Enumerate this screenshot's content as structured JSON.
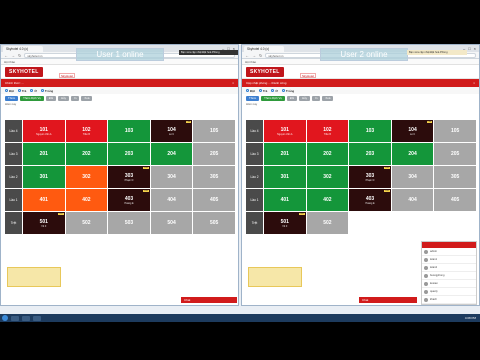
{
  "left": {
    "tab_title": "Skyhotel 4.0 (c)",
    "url": "skyhotel.vn",
    "bookmarks": "Hội thảo",
    "logo": "SKYHOTEL",
    "hotel_button": "SkyHotel",
    "banner": "User 1 online",
    "notice": "Bạn vừa cập nhật Đặt hoà Phòng",
    "alert": "Chính thức: ...",
    "toolbar": [
      "Đặt",
      "Trả",
      "Ở",
      "Trống"
    ],
    "actions": [
      {
        "label": "Thêm",
        "color": "blue"
      },
      {
        "label": "Thêm Dịch Vụ",
        "color": "green"
      },
      {
        "label": "Đổi",
        "color": "gray"
      },
      {
        "label": "Hủy",
        "color": "gray"
      },
      {
        "label": "In",
        "color": "gray"
      },
      {
        "label": "Xoá",
        "color": "gray"
      }
    ],
    "subline": "Hôm nay",
    "bottom_button": "Chat",
    "floors": [
      {
        "label": "Lầu 4",
        "rooms": [
          {
            "num": "101",
            "color": "red",
            "guest": "Nguyễn Văn A"
          },
          {
            "num": "102",
            "color": "red",
            "guest": "Trần B"
          },
          {
            "num": "103",
            "color": "green",
            "guest": ""
          },
          {
            "num": "104",
            "color": "dark",
            "guest": "Lê C",
            "tag": "Chờ"
          },
          {
            "num": "105",
            "color": "gray",
            "guest": ""
          }
        ]
      },
      {
        "label": "Lầu 3",
        "rooms": [
          {
            "num": "201",
            "color": "green",
            "guest": ""
          },
          {
            "num": "202",
            "color": "green",
            "guest": ""
          },
          {
            "num": "203",
            "color": "green",
            "guest": ""
          },
          {
            "num": "204",
            "color": "green",
            "guest": ""
          },
          {
            "num": "205",
            "color": "gray",
            "guest": ""
          }
        ]
      },
      {
        "label": "Lầu 2",
        "rooms": [
          {
            "num": "301",
            "color": "green",
            "guest": ""
          },
          {
            "num": "302",
            "color": "orange",
            "guest": ""
          },
          {
            "num": "303",
            "color": "dark",
            "guest": "Phạm D",
            "tag": "Chờ"
          },
          {
            "num": "304",
            "color": "gray",
            "guest": ""
          },
          {
            "num": "305",
            "color": "gray",
            "guest": ""
          }
        ]
      },
      {
        "label": "Lầu 1",
        "rooms": [
          {
            "num": "401",
            "color": "orange",
            "guest": ""
          },
          {
            "num": "402",
            "color": "orange",
            "guest": ""
          },
          {
            "num": "403",
            "color": "dark",
            "guest": "Hoàng E",
            "tag": "Chờ"
          },
          {
            "num": "404",
            "color": "gray",
            "guest": ""
          },
          {
            "num": "405",
            "color": "gray",
            "guest": ""
          }
        ]
      },
      {
        "label": "Trệt",
        "rooms": [
          {
            "num": "501",
            "color": "dark",
            "guest": "Vũ F",
            "tag": "Chờ"
          },
          {
            "num": "502",
            "color": "gray",
            "guest": ""
          },
          {
            "num": "503",
            "color": "gray",
            "guest": ""
          },
          {
            "num": "504",
            "color": "gray",
            "guest": ""
          },
          {
            "num": "505",
            "color": "gray",
            "guest": ""
          }
        ]
      }
    ]
  },
  "right": {
    "tab_title": "Skyhotel 4.0 (c)",
    "url": "skyhotel.vn",
    "bookmarks": "Hội thảo",
    "logo": "SKYHOTEL",
    "hotel_button": "SkyHotel",
    "banner": "User 2 online",
    "notice": "Bạn vừa cập nhật Đặt hoà Phòng",
    "alert": "Cập nhật phòng ... thành công",
    "toolbar": [
      "Đặt",
      "Trả",
      "Ở",
      "Trống"
    ],
    "actions": [
      {
        "label": "Thêm",
        "color": "blue"
      },
      {
        "label": "Thêm Dịch Vụ",
        "color": "green"
      },
      {
        "label": "Đổi",
        "color": "gray"
      },
      {
        "label": "Hủy",
        "color": "gray"
      },
      {
        "label": "In",
        "color": "gray"
      },
      {
        "label": "Xoá",
        "color": "gray"
      }
    ],
    "subline": "Hôm nay",
    "bottom_button": "Chat",
    "floors": [
      {
        "label": "Lầu 4",
        "rooms": [
          {
            "num": "101",
            "color": "red",
            "guest": "Nguyễn Văn A"
          },
          {
            "num": "102",
            "color": "red",
            "guest": "Trần B"
          },
          {
            "num": "103",
            "color": "green",
            "guest": ""
          },
          {
            "num": "104",
            "color": "dark",
            "guest": "Lê C",
            "tag": "Chờ"
          },
          {
            "num": "105",
            "color": "gray",
            "guest": ""
          }
        ]
      },
      {
        "label": "Lầu 3",
        "rooms": [
          {
            "num": "201",
            "color": "green",
            "guest": ""
          },
          {
            "num": "202",
            "color": "green",
            "guest": ""
          },
          {
            "num": "203",
            "color": "green",
            "guest": ""
          },
          {
            "num": "204",
            "color": "green",
            "guest": ""
          },
          {
            "num": "205",
            "color": "gray",
            "guest": ""
          }
        ]
      },
      {
        "label": "Lầu 2",
        "rooms": [
          {
            "num": "301",
            "color": "green",
            "guest": ""
          },
          {
            "num": "302",
            "color": "green",
            "guest": ""
          },
          {
            "num": "303",
            "color": "dark",
            "guest": "Phạm D",
            "tag": "Chờ"
          },
          {
            "num": "304",
            "color": "gray",
            "guest": ""
          },
          {
            "num": "305",
            "color": "gray",
            "guest": ""
          }
        ]
      },
      {
        "label": "Lầu 1",
        "rooms": [
          {
            "num": "401",
            "color": "green",
            "guest": ""
          },
          {
            "num": "402",
            "color": "green",
            "guest": ""
          },
          {
            "num": "403",
            "color": "dark",
            "guest": "Hoàng E",
            "tag": "Chờ"
          },
          {
            "num": "404",
            "color": "gray",
            "guest": ""
          },
          {
            "num": "405",
            "color": "gray",
            "guest": ""
          }
        ]
      },
      {
        "label": "Trệt",
        "rooms": [
          {
            "num": "501",
            "color": "dark",
            "guest": "Vũ F",
            "tag": "Chờ"
          },
          {
            "num": "502",
            "color": "gray",
            "guest": ""
          },
          {
            "num": "503",
            "color": "empty",
            "guest": ""
          },
          {
            "num": "504",
            "color": "empty",
            "guest": ""
          },
          {
            "num": "505",
            "color": "empty",
            "guest": ""
          }
        ]
      }
    ],
    "chat_users": [
      "admin",
      "letan1",
      "letan2",
      "buongphong",
      "ketoan",
      "quanly",
      "khach"
    ]
  },
  "taskbar_clock": "4:08 PM"
}
